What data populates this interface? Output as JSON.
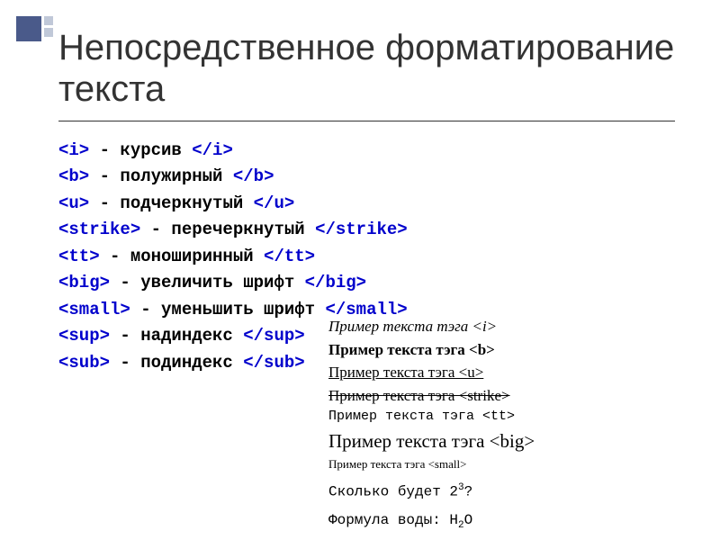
{
  "title": "Непосредственное форматирование текста",
  "tags": [
    {
      "open": "<i>",
      "desc": " - курсив ",
      "close": "</i>"
    },
    {
      "open": "<b>",
      "desc": " - полужирный ",
      "close": "</b>"
    },
    {
      "open": "<u>",
      "desc": " - подчеркнутый ",
      "close": "</u>"
    },
    {
      "open": "<strike>",
      "desc": " - перечеркнутый ",
      "close": "</strike>"
    },
    {
      "open": "<tt>",
      "desc": " - моноширинный ",
      "close": "</tt>"
    },
    {
      "open": "<big>",
      "desc": " - увеличить шрифт ",
      "close": "</big>"
    },
    {
      "open": "<small>",
      "desc": " - уменьшить шрифт ",
      "close": "</small>"
    },
    {
      "open": "<sup>",
      "desc": " - надиндекс ",
      "close": "</sup>"
    },
    {
      "open": "<sub>",
      "desc": " - подиндекс ",
      "close": "</sub>"
    }
  ],
  "examples": {
    "i": "Пример текста тэга <i>",
    "b": "Пример текста тэга <b>",
    "u": "Пример текста тэга <u>",
    "strike": "Пример текста тэга <strike>",
    "tt": "Пример текста тэга <tt>",
    "big": "Пример текста тэга <big>",
    "small": "Пример текста тэга <small>",
    "sup_q": "Сколько будет 2",
    "sup_v": "3",
    "sup_end": "?",
    "sub_q": "Формула воды: H",
    "sub_v": "2",
    "sub_end": "O"
  }
}
